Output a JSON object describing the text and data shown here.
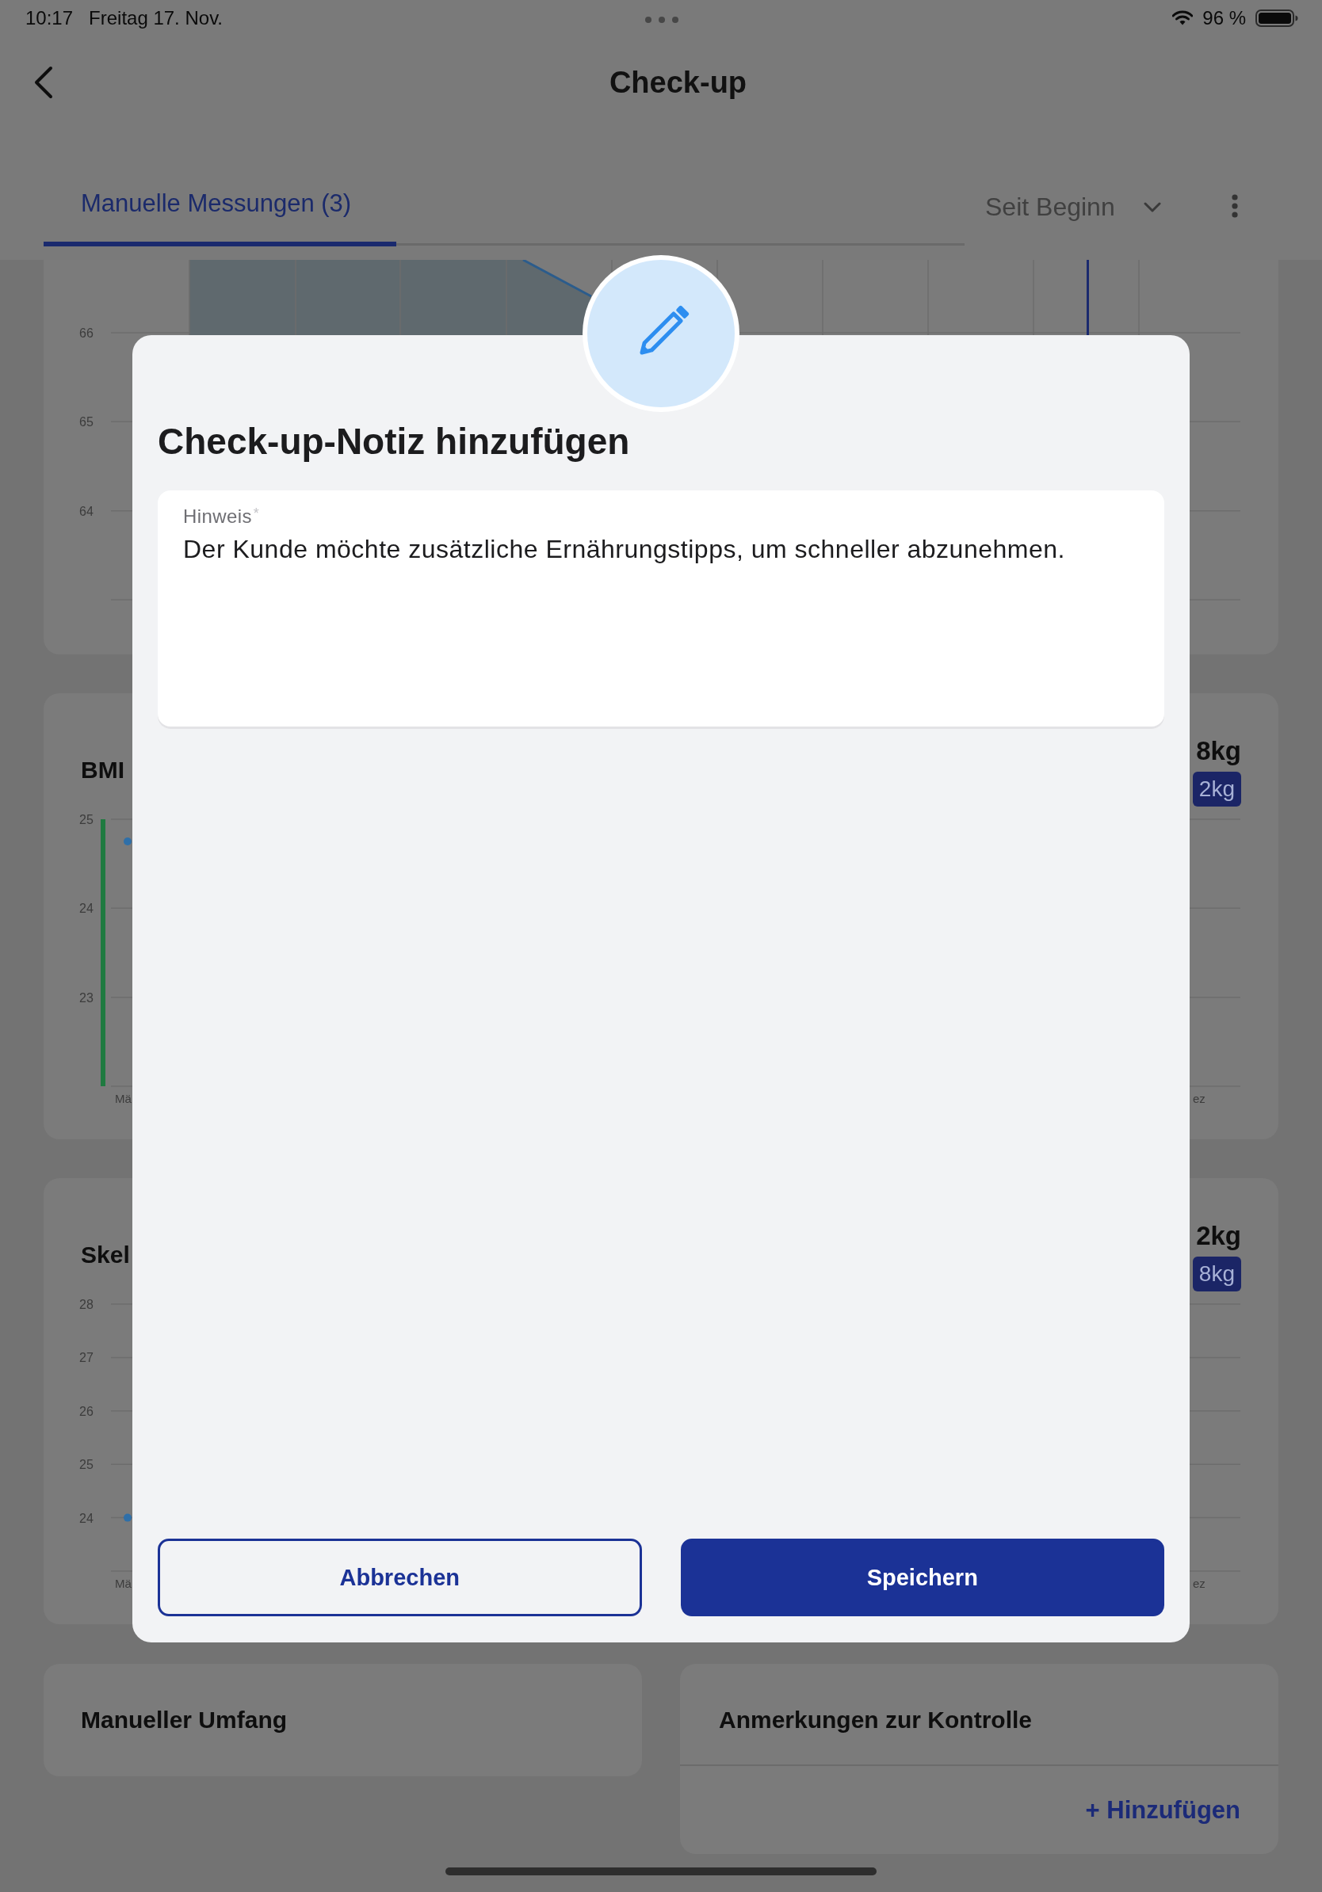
{
  "status_bar": {
    "time": "10:17",
    "date": "Freitag 17. Nov.",
    "battery": "96 %"
  },
  "header": {
    "title": "Check-up"
  },
  "tabs": [
    {
      "label": "Manuelle Messungen (3)",
      "selected": true
    }
  ],
  "period_filter": {
    "value": "Seit Beginn"
  },
  "chart_cards": [
    {
      "kind": "area",
      "y_labels": [
        "66",
        "65",
        "64"
      ]
    },
    {
      "kind": "bar",
      "title": "BMI",
      "value": "8kg",
      "badge": "2kg",
      "y_labels": [
        "25",
        "24",
        "23"
      ],
      "x_labels": [
        "Mä",
        "ez"
      ]
    },
    {
      "kind": "dot",
      "title": "Skel",
      "value": "2kg",
      "badge": "8kg",
      "y_labels": [
        "28",
        "27",
        "26",
        "25",
        "24"
      ],
      "x_labels": [
        "Mä",
        "ez"
      ]
    }
  ],
  "summary_cards": [
    {
      "title": "Manueller Umfang"
    },
    {
      "title": "Anmerkungen zur Kontrolle",
      "action": "+ Hinzufügen"
    }
  ],
  "dialog": {
    "title": "Check-up-Notiz hinzufügen",
    "field": {
      "label": "Hinweis",
      "required_mark": "*",
      "value": "Der Kunde möchte zusätzliche Ernährungstipps, um schneller abzunehmen."
    },
    "buttons": [
      {
        "label": "Abbrechen",
        "kind": "secondary"
      },
      {
        "label": "Speichern",
        "kind": "primary"
      }
    ]
  }
}
